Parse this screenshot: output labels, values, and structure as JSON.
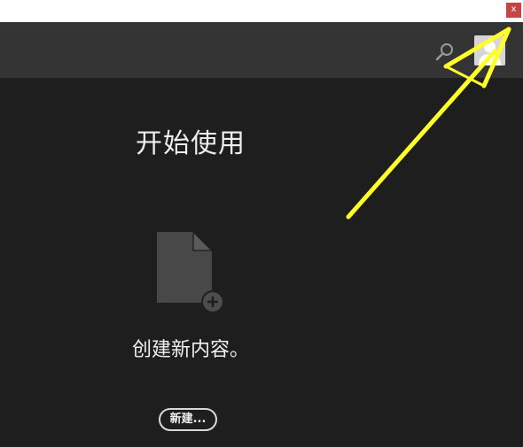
{
  "window": {
    "close_glyph": "x"
  },
  "header": {
    "search_icon": "search-icon",
    "avatar_icon": "user-avatar-icon"
  },
  "main": {
    "title": "开始使用",
    "new_doc_icon": "new-document-icon",
    "create_prompt": "创建新内容。",
    "new_button_label": "新建..."
  },
  "annotation": {
    "arrow_color": "#ffff2a",
    "arrow_target": "close-button"
  },
  "colors": {
    "background": "#1e1e1e",
    "header": "#343434",
    "close_button": "#c74444"
  }
}
